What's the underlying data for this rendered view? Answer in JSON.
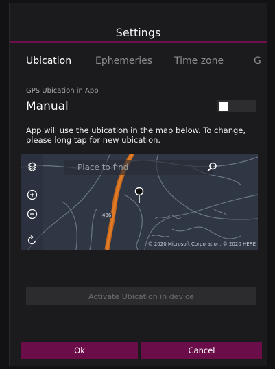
{
  "dialog": {
    "title": "Settings",
    "accent_color": "#6b0d48"
  },
  "tabs": [
    {
      "label": "Ubication",
      "active": true
    },
    {
      "label": "Ephemeries",
      "active": false
    },
    {
      "label": "Time zone",
      "active": false
    },
    {
      "label": "G",
      "active": false
    }
  ],
  "gps": {
    "label": "GPS Ubication in App",
    "value": "Manual",
    "toggle_on": true
  },
  "info_text": "App will use the ubication in the map below. To change, please long tap for new ubication.",
  "map": {
    "search_placeholder": "Place to find",
    "road_label": "436",
    "copyright": "© 2020 Microsoft Corporation, © 2020 HERE",
    "icons": [
      "layers-icon",
      "zoom-in-icon",
      "zoom-out-icon",
      "rotate-icon",
      "search-icon",
      "location-pin-icon"
    ]
  },
  "activate_button": "Activate Ubication in device",
  "buttons": {
    "ok": "Ok",
    "cancel": "Cancel"
  }
}
